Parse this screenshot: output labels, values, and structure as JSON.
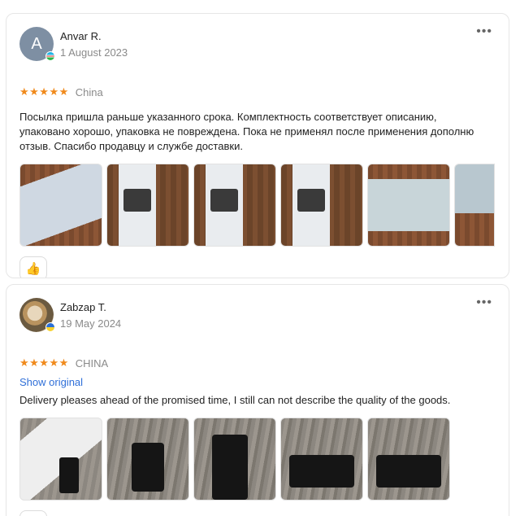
{
  "reviews": [
    {
      "avatar_letter": "A",
      "author": "Anvar R.",
      "date": "1 August 2023",
      "stars": "★★★★★",
      "country": "China",
      "text": "Посылка пришла раньше указанного срока. Комплектность соответствует описанию, упаковано хорошо, упаковка не повреждена. Пока не применял после применения дополню отзыв. Спасибо продавцу и службе доставки.",
      "more_icon": "•••",
      "like_icon": "👍"
    },
    {
      "author": "Zabzap T.",
      "date": "19 May 2024",
      "stars": "★★★★★",
      "country": "CHINA",
      "show_original": "Show original",
      "text": "Delivery pleases ahead of the promised time, I still can not describe the quality of the goods.",
      "more_icon": "•••",
      "like_icon": "👍"
    }
  ],
  "colors": {
    "star": "#f08a1c",
    "link": "#2f6fd8",
    "muted": "#8a8a8a"
  }
}
